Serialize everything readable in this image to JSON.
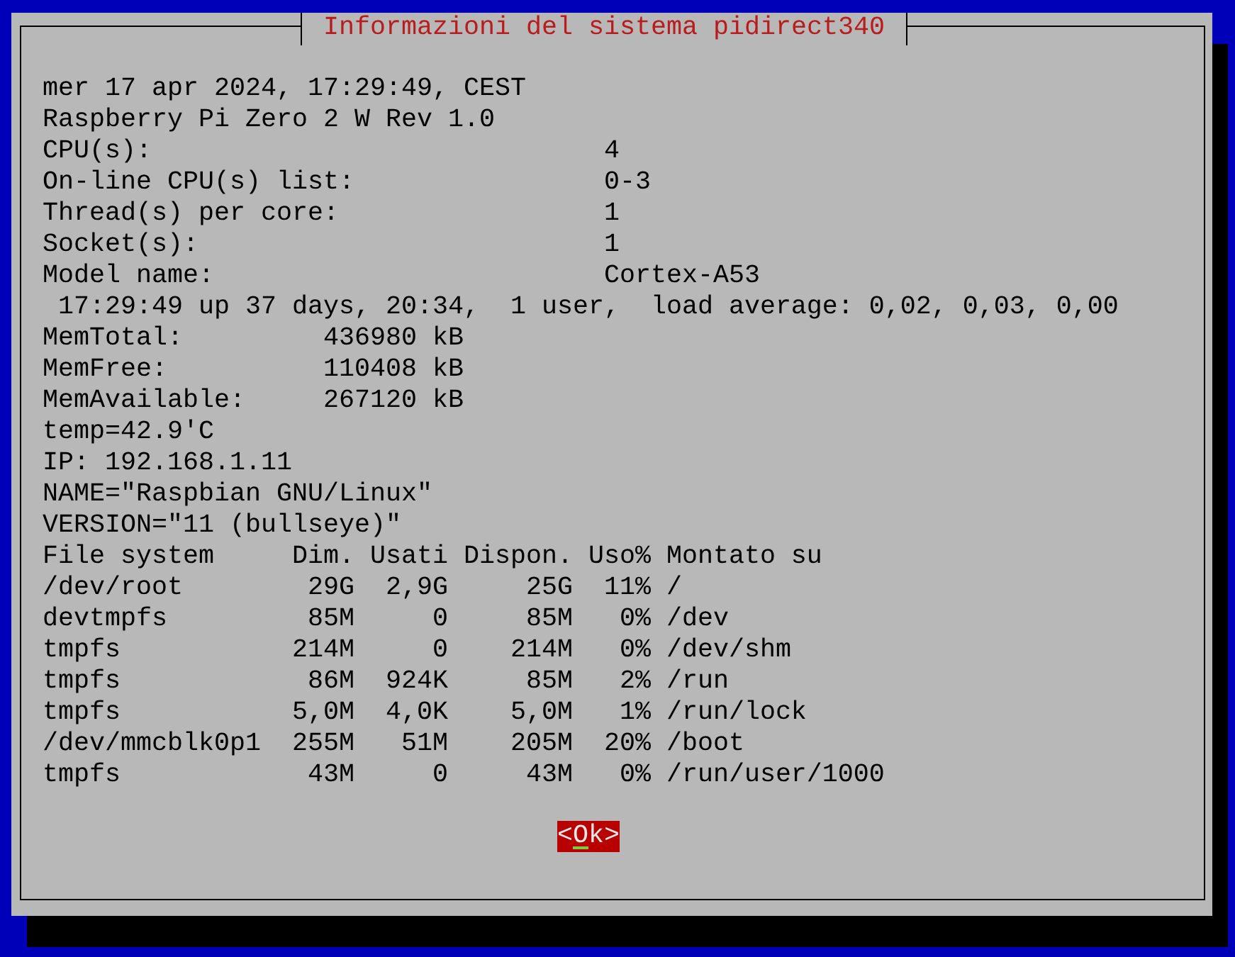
{
  "dialog": {
    "title": "Informazioni del sistema pidirect340",
    "lines": [
      "mer 17 apr 2024, 17:29:49, CEST",
      "Raspberry Pi Zero 2 W Rev 1.0",
      "CPU(s):                             4",
      "On-line CPU(s) list:                0-3",
      "Thread(s) per core:                 1",
      "Socket(s):                          1",
      "Model name:                         Cortex-A53",
      " 17:29:49 up 37 days, 20:34,  1 user,  load average: 0,02, 0,03, 0,00",
      "MemTotal:         436980 kB",
      "MemFree:          110408 kB",
      "MemAvailable:     267120 kB",
      "temp=42.9'C",
      "IP: 192.168.1.11",
      "NAME=\"Raspbian GNU/Linux\"",
      "VERSION=\"11 (bullseye)\"",
      "File system     Dim. Usati Dispon. Uso% Montato su",
      "/dev/root        29G  2,9G     25G  11% /",
      "devtmpfs         85M     0     85M   0% /dev",
      "tmpfs           214M     0    214M   0% /dev/shm",
      "tmpfs            86M  924K     85M   2% /run",
      "tmpfs           5,0M  4,0K    5,0M   1% /run/lock",
      "/dev/mmcblk0p1  255M   51M    205M  20% /boot",
      "tmpfs            43M     0     43M   0% /run/user/1000"
    ],
    "button": {
      "prefix": "<",
      "hotkey": "O",
      "suffix": "k>"
    }
  }
}
